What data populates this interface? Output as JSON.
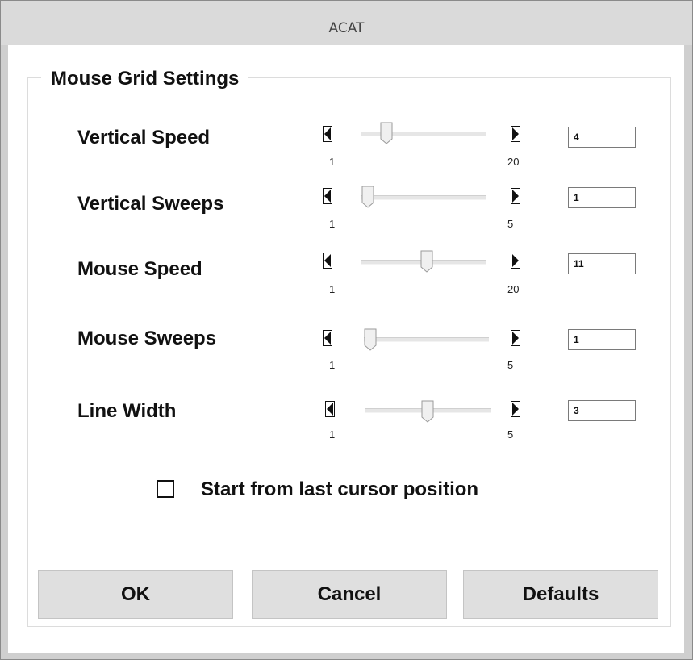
{
  "window": {
    "title": "ACAT"
  },
  "group": {
    "title": "Mouse Grid Settings"
  },
  "rows": [
    {
      "label": "Vertical Speed",
      "min": "1",
      "max": "20",
      "value": "4"
    },
    {
      "label": "Vertical Sweeps",
      "min": "1",
      "max": "5",
      "value": "1"
    },
    {
      "label": "Mouse Speed",
      "min": "1",
      "max": "20",
      "value": "11"
    },
    {
      "label": "Mouse Sweeps",
      "min": "1",
      "max": "5",
      "value": "1"
    },
    {
      "label": "Line Width",
      "min": "1",
      "max": "5",
      "value": "3"
    }
  ],
  "checkbox": {
    "label": "Start from last cursor position",
    "checked": false
  },
  "buttons": {
    "ok": "OK",
    "cancel": "Cancel",
    "defaults": "Defaults"
  },
  "icons": {
    "decrement": "triangle-left-icon",
    "increment": "triangle-right-icon",
    "thumb": "slider-thumb-icon"
  }
}
